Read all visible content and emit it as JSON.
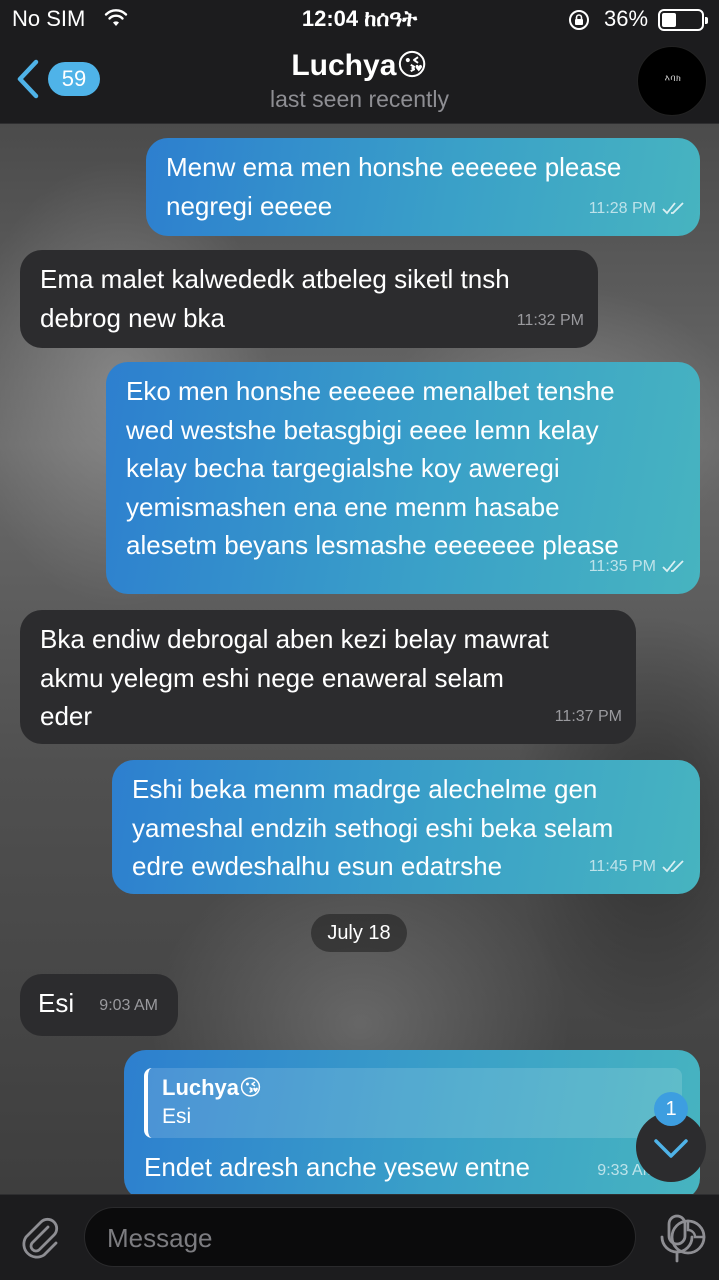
{
  "status_bar": {
    "carrier": "No SIM",
    "time": "12:04 ከሰዓት",
    "battery": "36%",
    "battery_level": 0.36
  },
  "header": {
    "back_count": "59",
    "name": "Luchya😘",
    "status": "last seen recently",
    "avatar_text": "እባክ"
  },
  "messages": [
    {
      "direction": "outgoing",
      "text": "Menw ema men honshe eeeeee please\nnegregi eeeee",
      "time": "11:28 PM",
      "read": true
    },
    {
      "direction": "incoming",
      "text": "Ema malet kalwededk atbeleg siketl tnsh\ndebrog new bka",
      "time": "11:32 PM"
    },
    {
      "direction": "outgoing",
      "text": "Eko men honshe eeeeee menalbet tenshe\nwed westshe betasgbigi eeee lemn kelay\nkelay becha targegialshe koy aweregi\nyemismashen ena ene menm hasabe\nalesetm beyans lesmashe eeeeeee please",
      "time": "11:35 PM",
      "read": true
    },
    {
      "direction": "incoming",
      "text": "Bka endiw debrogal aben kezi belay mawrat\nakmu yelegm eshi nege enaweral selam\neder",
      "time": "11:37 PM"
    },
    {
      "direction": "outgoing",
      "text": "Eshi beka menm madrge alechelme gen\nyameshal endzih sethogi eshi beka selam\nedre ewdeshalhu esun edatrshe",
      "time": "11:45 PM",
      "read": true
    },
    {
      "direction": "incoming",
      "text": "Esi",
      "time": "9:03 AM"
    },
    {
      "direction": "outgoing",
      "text": "Endet adresh anche yesew entne",
      "time": "9:33 AM",
      "read": true,
      "reply": {
        "name": "Luchya😘",
        "text": "Esi"
      }
    }
  ],
  "date_separator": "July 18",
  "scroll_badge": "1",
  "input": {
    "placeholder": "Message"
  },
  "colors": {
    "accent": "#4fb3e8",
    "incoming_bubble": "#2c2c2e",
    "outgoing_start": "#2d7fcf",
    "outgoing_end": "#47b4c0"
  },
  "icons": [
    "wifi-icon",
    "lock-rotation-icon",
    "battery-icon",
    "chevron-left-icon",
    "double-check-icon",
    "chevron-down-icon",
    "paperclip-icon",
    "sticker-icon",
    "microphone-icon"
  ]
}
